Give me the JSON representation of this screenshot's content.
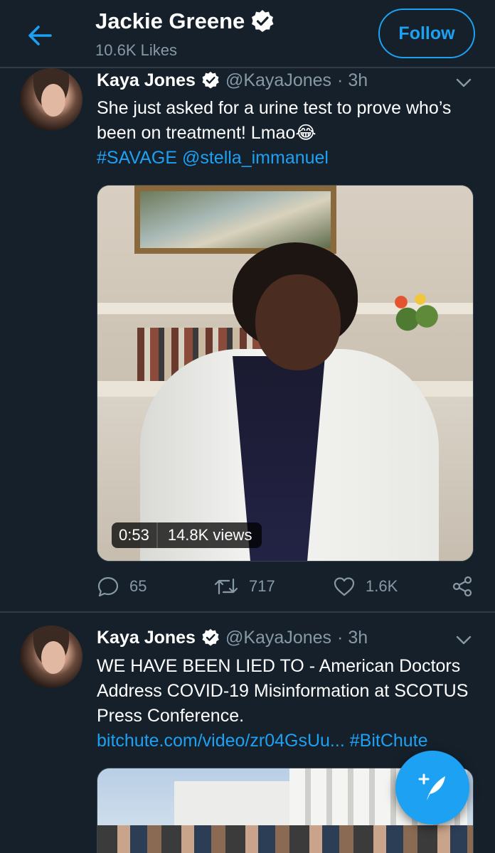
{
  "header": {
    "title": "Jackie Greene",
    "likes": "10.6K Likes",
    "follow_label": "Follow"
  },
  "tweets": [
    {
      "name": "Kaya Jones",
      "handle": "@KayaJones",
      "time": "· 3h",
      "text": "She just asked for a urine test to prove who’s been on treatment! Lmao😂",
      "hashtag": "#SAVAGE",
      "mention": "@stella_immanuel",
      "video": {
        "duration": "0:53",
        "views": "14.8K views"
      },
      "actions": {
        "replies": "65",
        "retweets": "717",
        "likes": "1.6K"
      }
    },
    {
      "name": "Kaya Jones",
      "handle": "@KayaJones",
      "time": "· 3h",
      "text": "WE HAVE BEEN LIED TO - American Doctors Address COVID-19 Misinformation at SCOTUS Press Conference.",
      "link": "bitchute.com/video/zr04GsUu...",
      "hashtag": "#BitChute"
    }
  ],
  "colors": {
    "background": "#15202b",
    "accent": "#1da1f2",
    "muted": "#8899a6",
    "divider": "#2f3b47"
  },
  "icons": {
    "back": "arrow-left-icon",
    "verified": "verified-badge-icon",
    "caret": "chevron-down-icon",
    "reply": "reply-icon",
    "retweet": "retweet-icon",
    "like": "heart-icon",
    "share": "share-icon",
    "compose": "compose-tweet-icon"
  }
}
